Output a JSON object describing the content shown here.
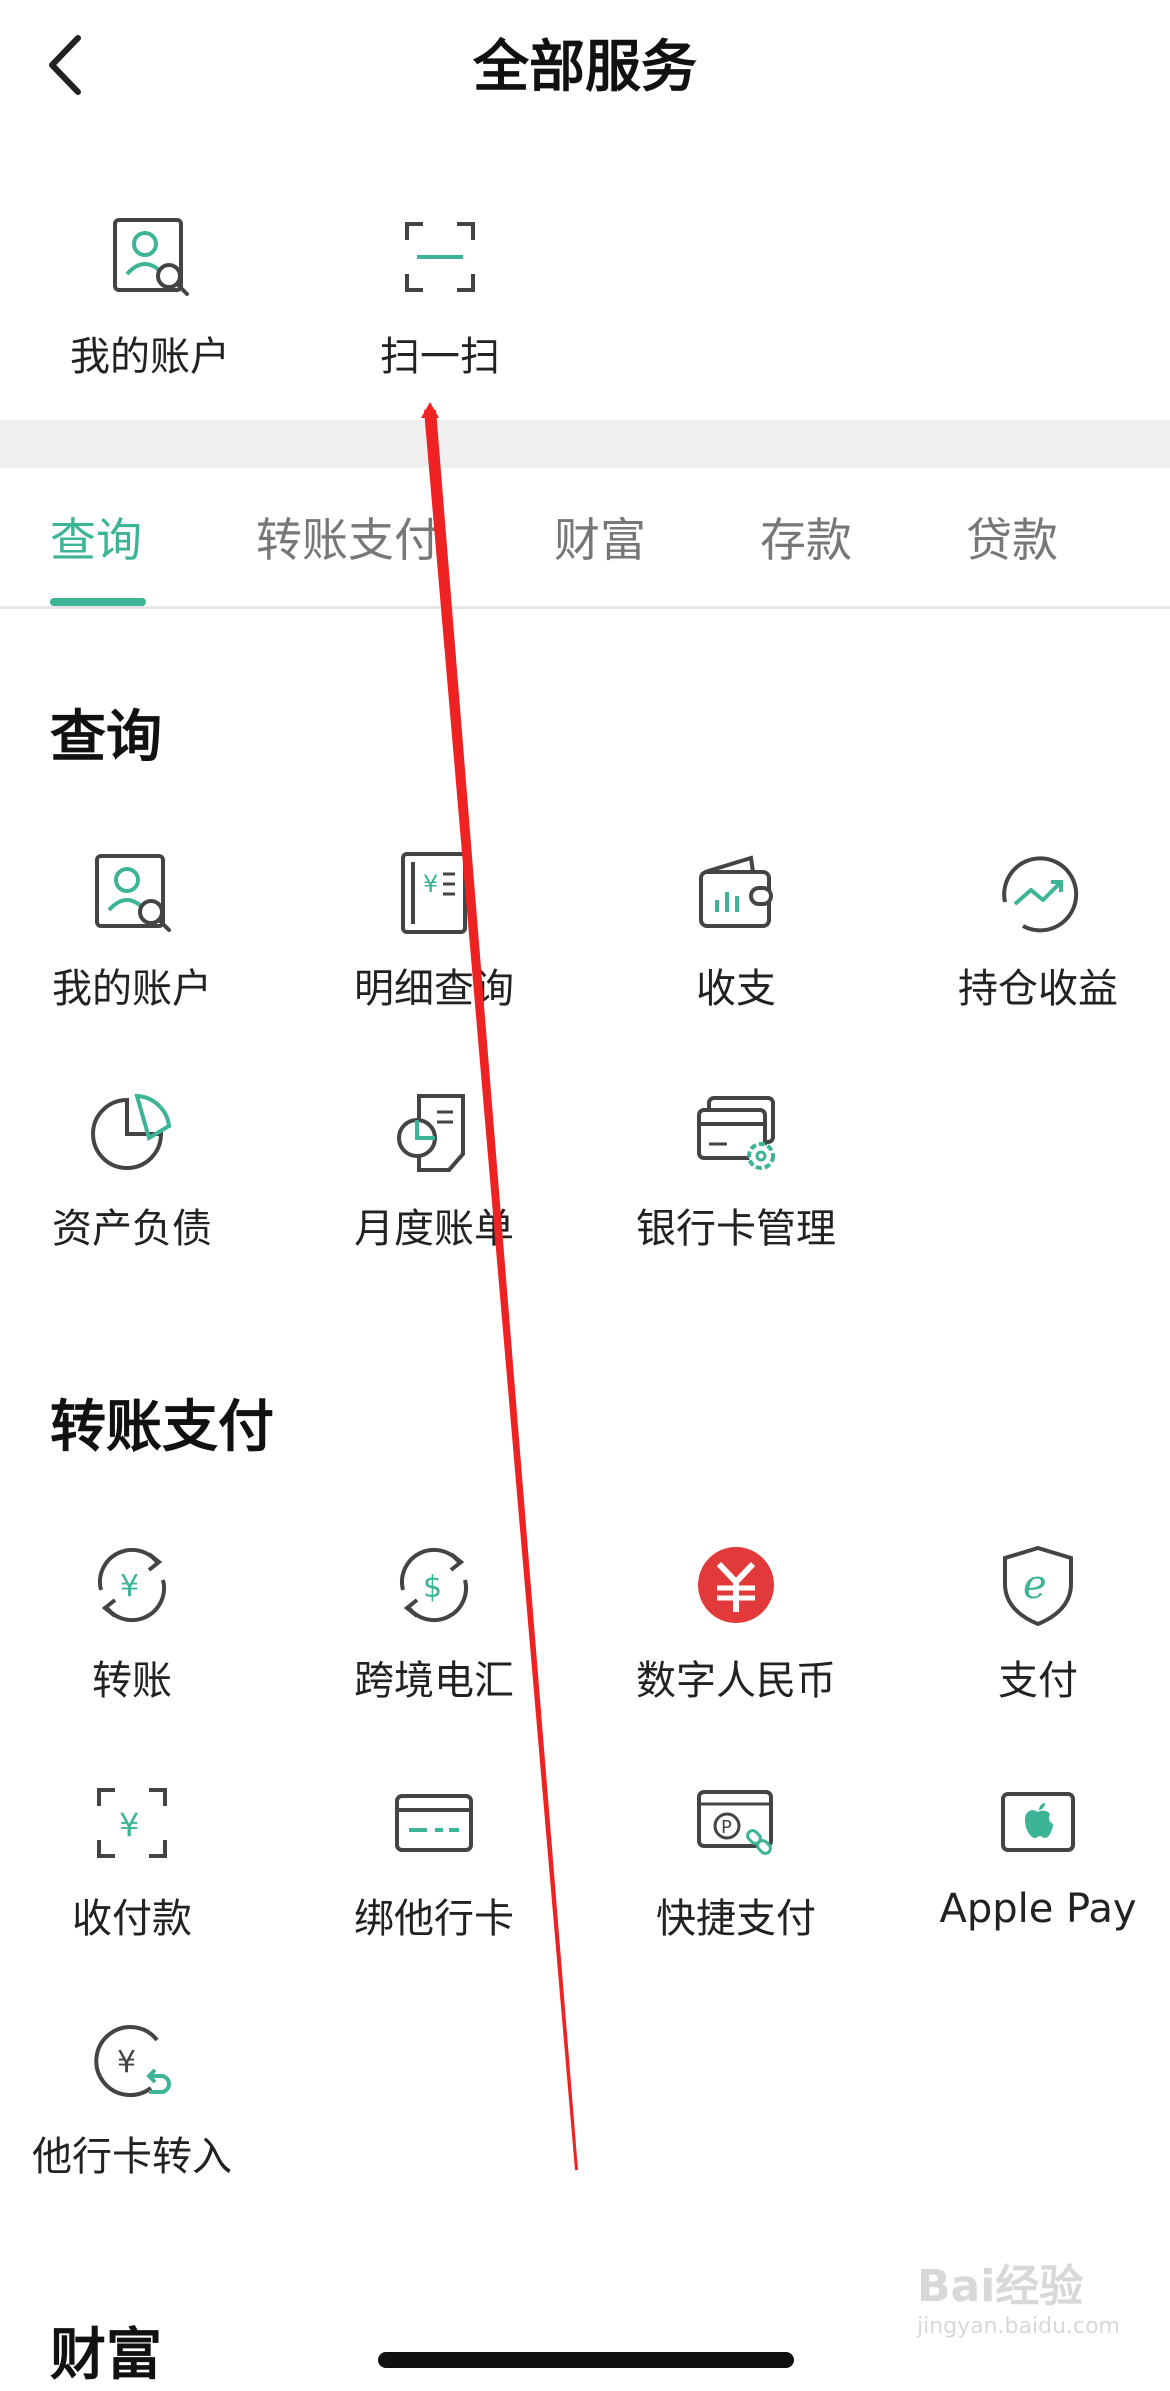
{
  "header": {
    "title": "全部服务"
  },
  "quick": [
    {
      "label": "我的账户",
      "icon": "account-search-icon"
    },
    {
      "label": "扫一扫",
      "icon": "scan-icon"
    }
  ],
  "tabs": [
    {
      "label": "查询",
      "active": true
    },
    {
      "label": "转账支付",
      "active": false
    },
    {
      "label": "财富",
      "active": false
    },
    {
      "label": "存款",
      "active": false
    },
    {
      "label": "贷款",
      "active": false
    }
  ],
  "sections": {
    "query": {
      "title": "查询",
      "items": [
        {
          "label": "我的账户",
          "icon": "account-search-icon"
        },
        {
          "label": "明细查询",
          "icon": "statement-icon"
        },
        {
          "label": "收支",
          "icon": "wallet-chart-icon"
        },
        {
          "label": "持仓收益",
          "icon": "trend-up-icon"
        },
        {
          "label": "资产负债",
          "icon": "pie-chart-icon"
        },
        {
          "label": "月度账单",
          "icon": "monthly-bill-icon"
        },
        {
          "label": "银行卡管理",
          "icon": "card-settings-icon"
        }
      ]
    },
    "transfer": {
      "title": "转账支付",
      "items": [
        {
          "label": "转账",
          "icon": "yuan-transfer-icon"
        },
        {
          "label": "跨境电汇",
          "icon": "dollar-transfer-icon"
        },
        {
          "label": "数字人民币",
          "icon": "digital-rmb-icon"
        },
        {
          "label": "支付",
          "icon": "e-pay-shield-icon"
        },
        {
          "label": "收付款",
          "icon": "scan-yuan-icon"
        },
        {
          "label": "绑他行卡",
          "icon": "bind-card-icon"
        },
        {
          "label": "快捷支付",
          "icon": "quick-pay-icon"
        },
        {
          "label": "Apple Pay",
          "icon": "apple-pay-icon"
        },
        {
          "label": "他行卡转入",
          "icon": "yuan-in-icon"
        }
      ]
    },
    "wealth": {
      "title": "财富"
    }
  },
  "watermark": {
    "brand": "Bai经验",
    "url": "jingyan.baidu.com"
  },
  "colors": {
    "accent": "#3cb495",
    "red": "#e23a3a",
    "annotation": "#ee2222"
  }
}
